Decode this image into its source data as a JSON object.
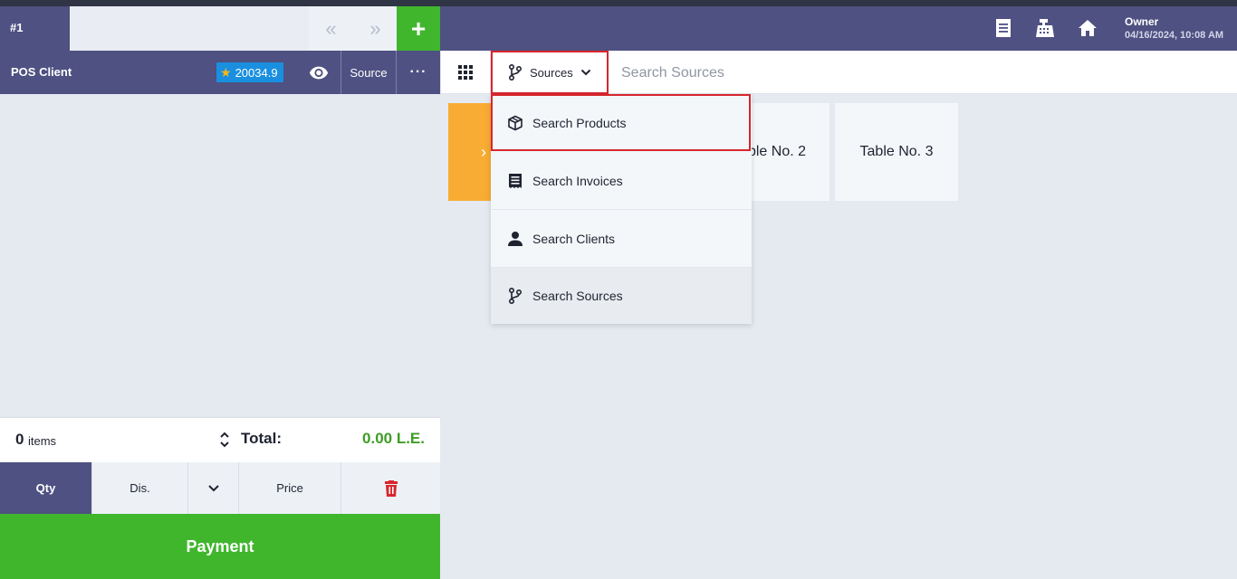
{
  "colors": {
    "header_bg": "#4e5181",
    "accent_green": "#40b62d",
    "highlight_red": "#d7262e",
    "badge_blue": "#1a8fe0",
    "tile_orange": "#f8ac34"
  },
  "order_tabs": {
    "current": "#1",
    "prev_icon": "«",
    "next_icon": "»",
    "add_icon": "+"
  },
  "client": {
    "name": "POS Client",
    "points": "20034.9",
    "source_label": "Source",
    "more_icon": "···"
  },
  "totals": {
    "count": "0",
    "count_label": "items",
    "total_label": "Total:",
    "total_value": "0.00 L.E."
  },
  "keypad": {
    "qty": "Qty",
    "discount": "Dis.",
    "price": "Price"
  },
  "payment_label": "Payment",
  "header": {
    "icons": [
      "receipt-icon",
      "cash-register-icon",
      "home-icon"
    ],
    "user": "Owner",
    "datetime": "04/16/2024, 10:08 AM"
  },
  "search": {
    "source_button": "Sources",
    "placeholder": "Search Sources"
  },
  "dropdown": {
    "items": [
      {
        "label": "Search Products",
        "icon": "cube-icon"
      },
      {
        "label": "Search Invoices",
        "icon": "invoice-icon"
      },
      {
        "label": "Search Clients",
        "icon": "person-icon"
      },
      {
        "label": "Search Sources",
        "icon": "source-branch-icon"
      }
    ]
  },
  "tiles": [
    {
      "label": "›"
    },
    {
      "label": "ble No. 2"
    },
    {
      "label": "Table No. 3"
    }
  ]
}
